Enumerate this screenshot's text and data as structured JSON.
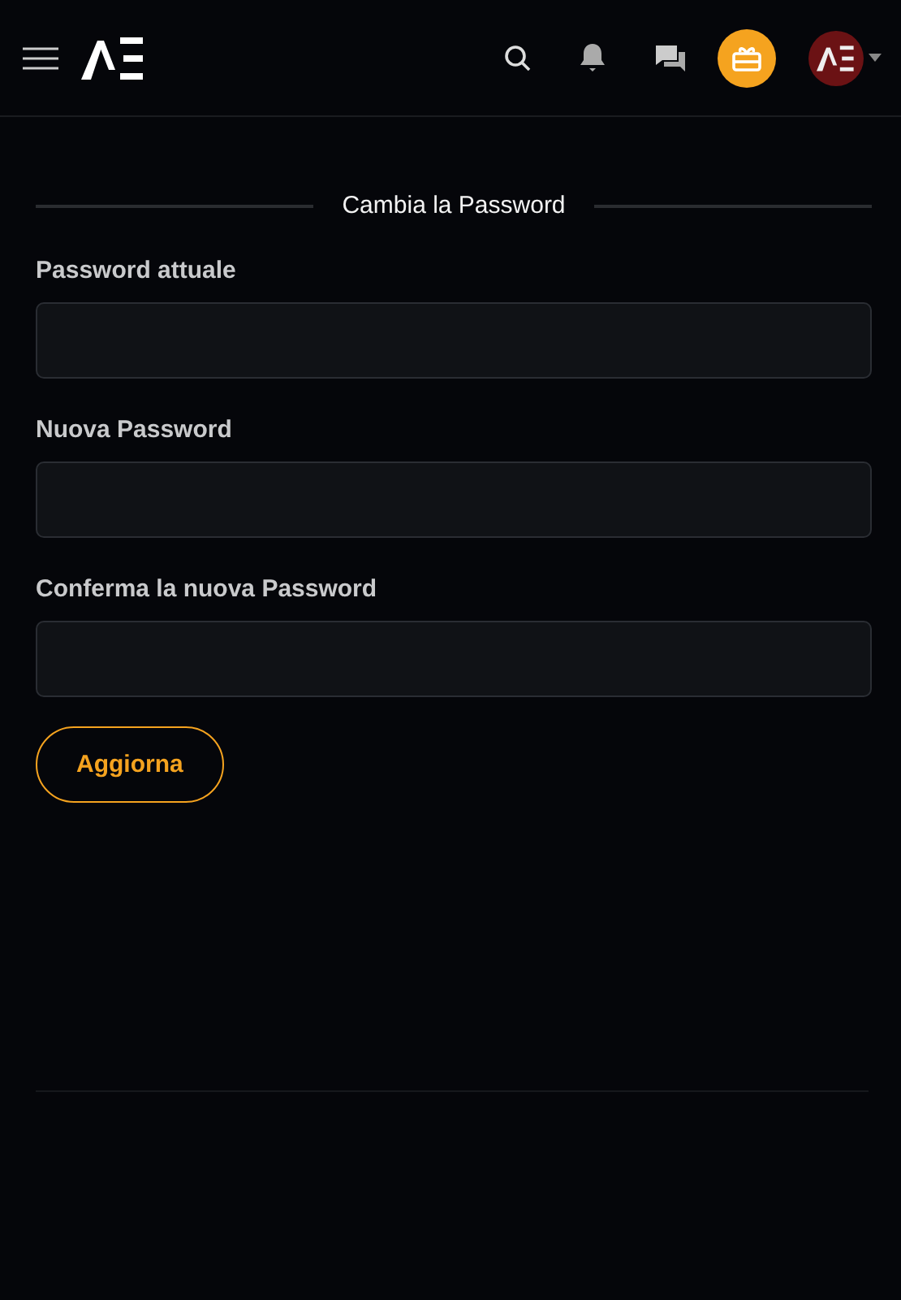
{
  "section": {
    "title": "Cambia la Password"
  },
  "fields": [
    {
      "label": "Password attuale"
    },
    {
      "label": "Nuova Password"
    },
    {
      "label": "Conferma la nuova Password"
    }
  ],
  "submit": {
    "label": "Aggiorna"
  }
}
